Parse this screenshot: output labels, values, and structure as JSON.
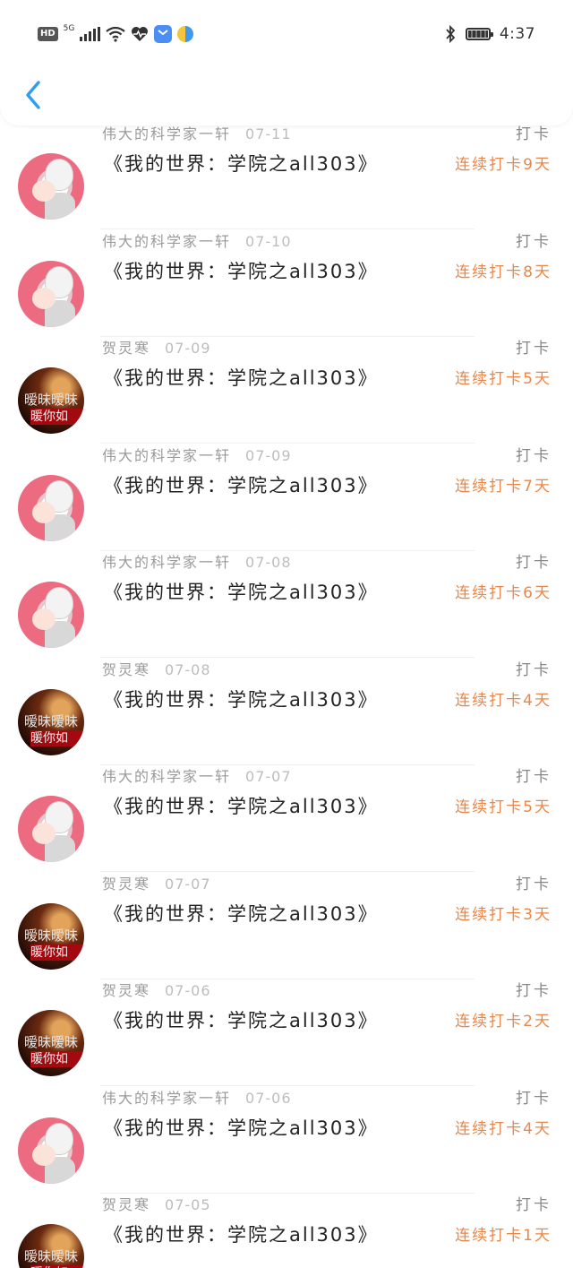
{
  "status_bar": {
    "hd": "HD",
    "network": "5G",
    "time": "4:37",
    "icons": [
      "hd-badge",
      "signal-icon",
      "wifi-icon",
      "health-icon",
      "app-icon",
      "app-icon",
      "bluetooth-icon",
      "battery-icon"
    ]
  },
  "header": {
    "back_icon": "chevron-left-icon",
    "accent": "#2f9df0"
  },
  "colors": {
    "streak": "#e9874a",
    "name": "#9a9a9a",
    "date": "#bdbdbd",
    "title": "#222222"
  },
  "items": [
    {
      "name": "伟大的科学家一轩",
      "date": "07-11",
      "title": "《我的世界：学院之all303》",
      "tag": "打卡",
      "streak": "连续打卡9天",
      "avatar_text": "",
      "avatar_sub": "",
      "avatar": "anime"
    },
    {
      "name": "伟大的科学家一轩",
      "date": "07-10",
      "title": "《我的世界：学院之all303》",
      "tag": "打卡",
      "streak": "连续打卡8天",
      "avatar_text": "",
      "avatar_sub": "",
      "avatar": "anime"
    },
    {
      "name": "贺灵寒",
      "date": "07-09",
      "title": "《我的世界：学院之all303》",
      "tag": "打卡",
      "streak": "连续打卡5天",
      "avatar_text": "暧昧暧昧",
      "avatar_sub": "暖你如",
      "avatar": "dark"
    },
    {
      "name": "伟大的科学家一轩",
      "date": "07-09",
      "title": "《我的世界：学院之all303》",
      "tag": "打卡",
      "streak": "连续打卡7天",
      "avatar_text": "",
      "avatar_sub": "",
      "avatar": "anime"
    },
    {
      "name": "伟大的科学家一轩",
      "date": "07-08",
      "title": "《我的世界：学院之all303》",
      "tag": "打卡",
      "streak": "连续打卡6天",
      "avatar_text": "",
      "avatar_sub": "",
      "avatar": "anime"
    },
    {
      "name": "贺灵寒",
      "date": "07-08",
      "title": "《我的世界：学院之all303》",
      "tag": "打卡",
      "streak": "连续打卡4天",
      "avatar_text": "暧昧暧昧",
      "avatar_sub": "暖你如",
      "avatar": "dark"
    },
    {
      "name": "伟大的科学家一轩",
      "date": "07-07",
      "title": "《我的世界：学院之all303》",
      "tag": "打卡",
      "streak": "连续打卡5天",
      "avatar_text": "",
      "avatar_sub": "",
      "avatar": "anime"
    },
    {
      "name": "贺灵寒",
      "date": "07-07",
      "title": "《我的世界：学院之all303》",
      "tag": "打卡",
      "streak": "连续打卡3天",
      "avatar_text": "暧昧暧昧",
      "avatar_sub": "暖你如",
      "avatar": "dark"
    },
    {
      "name": "贺灵寒",
      "date": "07-06",
      "title": "《我的世界：学院之all303》",
      "tag": "打卡",
      "streak": "连续打卡2天",
      "avatar_text": "暧昧暧昧",
      "avatar_sub": "暖你如",
      "avatar": "dark"
    },
    {
      "name": "伟大的科学家一轩",
      "date": "07-06",
      "title": "《我的世界：学院之all303》",
      "tag": "打卡",
      "streak": "连续打卡4天",
      "avatar_text": "",
      "avatar_sub": "",
      "avatar": "anime"
    },
    {
      "name": "贺灵寒",
      "date": "07-05",
      "title": "《我的世界：学院之all303》",
      "tag": "打卡",
      "streak": "连续打卡1天",
      "avatar_text": "暧昧暧昧",
      "avatar_sub": "暖你如",
      "avatar": "dark"
    }
  ]
}
